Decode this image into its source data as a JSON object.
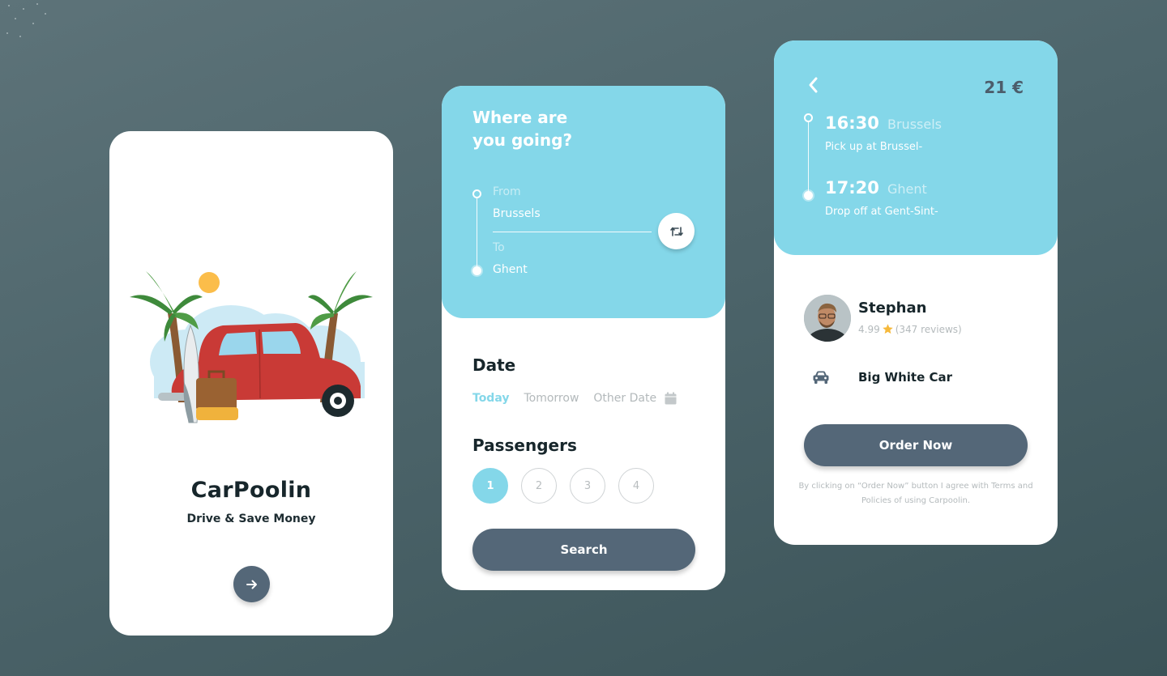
{
  "screens": {
    "welcome": {
      "title": "CarPoolin",
      "subtitle": "Drive & Save Money",
      "next_icon": "arrow-right-icon",
      "illustration": "car-beach-illustration"
    },
    "search": {
      "question": "Where are\nyou going?",
      "from_label": "From",
      "from_value": "Brussels",
      "to_label": "To",
      "to_value": "Ghent",
      "swap_icon": "swap-icon",
      "date_title": "Date",
      "date_options": [
        {
          "label": "Today",
          "active": true
        },
        {
          "label": "Tomorrow",
          "active": false
        },
        {
          "label": "Other Date",
          "active": false
        }
      ],
      "calendar_icon": "calendar-icon",
      "passengers_title": "Passengers",
      "passengers": [
        {
          "label": "1",
          "active": true
        },
        {
          "label": "2",
          "active": false
        },
        {
          "label": "3",
          "active": false
        },
        {
          "label": "4",
          "active": false
        }
      ],
      "search_label": "Search"
    },
    "details": {
      "back_icon": "chevron-left-icon",
      "price": "21 €",
      "pickup": {
        "time": "16:30",
        "city": "Brussels",
        "desc": "Pick up at Brussel-"
      },
      "dropoff": {
        "time": "17:20",
        "city": "Ghent",
        "desc": "Drop off at Gent-Sint-"
      },
      "driver": {
        "name": "Stephan",
        "rating": "4.99",
        "reviews": "(347 reviews)"
      },
      "car": "Big White Car",
      "order_label": "Order Now",
      "terms": "By clicking on “Order Now” button I agree with Terms and Policies of using Carpoolin."
    }
  },
  "colors": {
    "accent": "#84d7e9",
    "button": "#546778",
    "text_dark": "#17262b",
    "muted": "#b4babc",
    "star": "#f6b93b"
  }
}
